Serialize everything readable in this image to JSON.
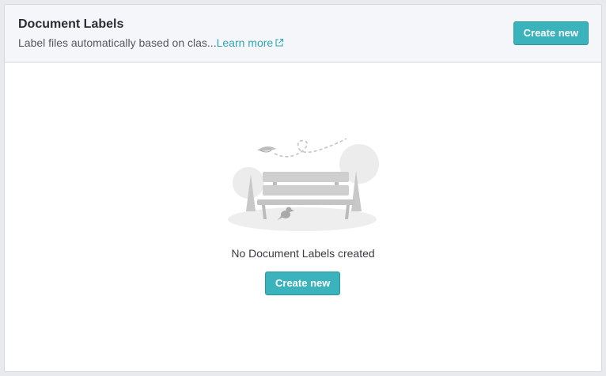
{
  "header": {
    "title": "Document Labels",
    "subtitle": "Label files automatically based on clas...",
    "learn_more": "Learn more",
    "create_label": "Create new"
  },
  "empty_state": {
    "message": "No Document Labels created",
    "create_label": "Create new"
  },
  "icons": {
    "external_link": "external-link-icon",
    "illustration": "park-bench-illustration"
  },
  "colors": {
    "accent": "#3bb3bd",
    "link": "#2fa7b3",
    "header_bg": "#f5f6f9"
  }
}
